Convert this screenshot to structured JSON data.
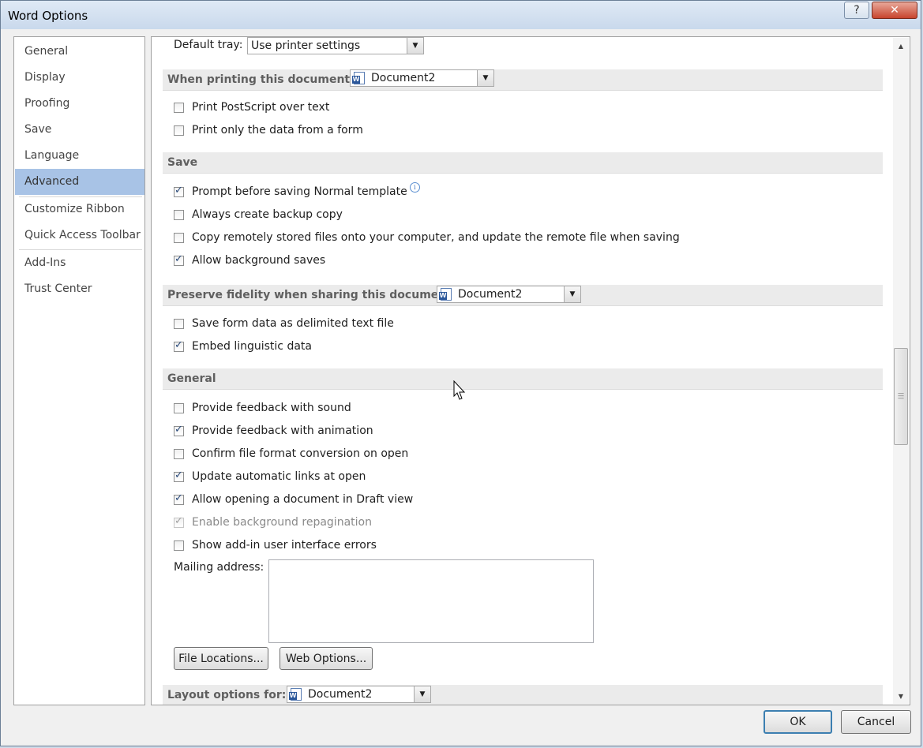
{
  "window": {
    "title": "Word Options",
    "help_icon": "?",
    "close_icon": "✕"
  },
  "nav": {
    "items": [
      {
        "label": "General"
      },
      {
        "label": "Display"
      },
      {
        "label": "Proofing"
      },
      {
        "label": "Save"
      },
      {
        "label": "Language"
      },
      {
        "label": "Advanced",
        "selected": true
      },
      {
        "label": "Customize Ribbon"
      },
      {
        "label": "Quick Access Toolbar"
      },
      {
        "label": "Add-Ins"
      },
      {
        "label": "Trust Center"
      }
    ]
  },
  "print": {
    "default_tray_label": "Default tray:",
    "default_tray_value": "Use printer settings",
    "when_printing_title": "When printing this document:",
    "when_printing_doc": "Document2",
    "postscript": {
      "label": "Print PostScript over text",
      "checked": false
    },
    "form_data": {
      "label": "Print only the data from a form",
      "checked": false
    }
  },
  "save": {
    "title": "Save",
    "prompt_normal": {
      "label": "Prompt before saving Normal template",
      "checked": true,
      "info_icon": "i"
    },
    "backup": {
      "label": "Always create backup copy",
      "checked": false
    },
    "copy_remote": {
      "label": "Copy remotely stored files onto your computer, and update the remote file when saving",
      "checked": false
    },
    "background_saves": {
      "label": "Allow background saves",
      "checked": true
    }
  },
  "fidelity": {
    "title": "Preserve fidelity when sharing this document:",
    "doc": "Document2",
    "form_delimited": {
      "label": "Save form data as delimited text file",
      "checked": false
    },
    "linguistic": {
      "label": "Embed linguistic data",
      "checked": true
    }
  },
  "general": {
    "title": "General",
    "sound": {
      "label": "Provide feedback with sound",
      "checked": false
    },
    "animation": {
      "label": "Provide feedback with animation",
      "checked": true
    },
    "confirm_conversion": {
      "label": "Confirm file format conversion on open",
      "checked": false
    },
    "update_links": {
      "label": "Update automatic links at open",
      "checked": true
    },
    "draft_view": {
      "label": "Allow opening a document in Draft view",
      "checked": true
    },
    "repagination": {
      "label": "Enable background repagination",
      "checked": true,
      "disabled": true
    },
    "addin_errors": {
      "label": "Show add-in user interface errors",
      "checked": false
    },
    "mailing_label": "Mailing address:",
    "mailing_value": "",
    "file_locations": "File Locations...",
    "web_options": "Web Options..."
  },
  "layout": {
    "title": "Layout options for:",
    "doc": "Document2"
  },
  "footer": {
    "ok": "OK",
    "cancel": "Cancel"
  },
  "colors": {
    "nav_selected": "#a8c3e6",
    "section_bg": "#ebebeb",
    "check": "#2a4a7a"
  }
}
